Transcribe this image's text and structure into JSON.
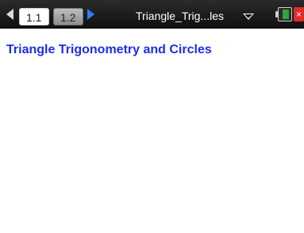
{
  "tabs": [
    {
      "label": "1.1",
      "active": true
    },
    {
      "label": "1.2",
      "active": false
    }
  ],
  "topbar": {
    "document_title": "Triangle_Trig...les",
    "icons": {
      "nav_left": "left-arrow-icon",
      "nav_right": "right-arrow-icon",
      "title_dropdown": "chevron-down-icon",
      "battery": "battery-icon",
      "close": "close-icon"
    },
    "colors": {
      "bar": "#1a1a1a",
      "nav_right": "#2d7df7",
      "battery_fill": "#2fa53a",
      "close": "#e02b2b"
    }
  },
  "content": {
    "heading": "Triangle Trigonometry and Circles",
    "heading_color": "#1f2cf0"
  }
}
